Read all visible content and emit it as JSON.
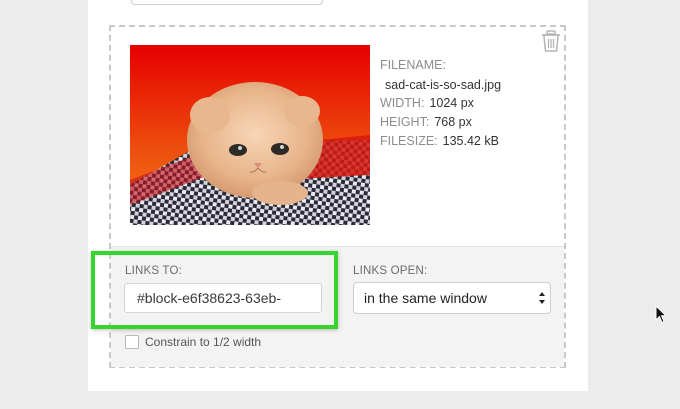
{
  "image_block": {
    "filename_label": "FILENAME:",
    "filename": "sad-cat-is-so-sad.jpg",
    "width_label": "WIDTH:",
    "width": "1024 px",
    "height_label": "HEIGHT:",
    "height": "768 px",
    "filesize_label": "FILESIZE:",
    "filesize": "135.42 kB",
    "delete_icon": "trash-icon",
    "image_alt": "sad-cat-is-so-sad.jpg"
  },
  "settings": {
    "links_to_label": "LINKS TO:",
    "links_to_value": "#block-e6f38623-63eb-",
    "links_open_label": "LINKS OPEN:",
    "links_open_selected": "in the same window",
    "constrain_label": "Constrain to 1/2 width",
    "constrain_checked": false
  },
  "colors": {
    "highlight": "#35d52e",
    "dashed_border": "#c8c8c8",
    "settings_bg": "#f3f3f3"
  }
}
